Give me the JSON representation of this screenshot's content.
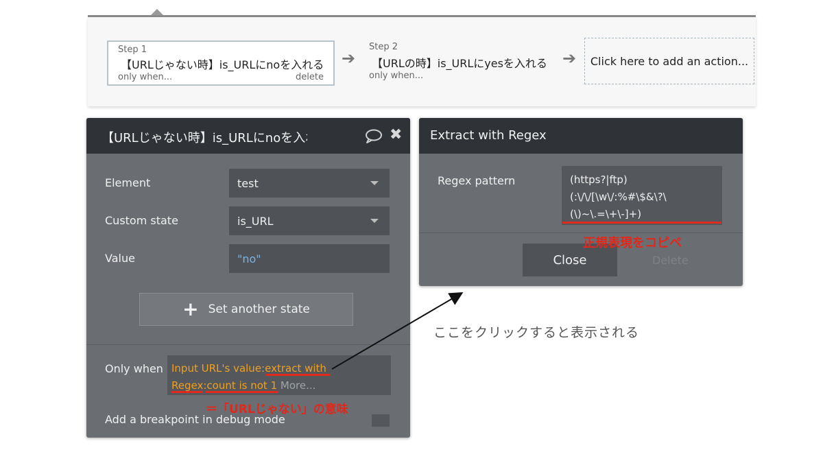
{
  "workflow": {
    "step1": {
      "label": "Step 1",
      "title": "【URLじゃない時】is_URLにnoを入れる",
      "sub": "only when...",
      "delete": "delete"
    },
    "step2": {
      "label": "Step 2",
      "title": "【URLの時】is_URLにyesを入れる",
      "sub": "only when..."
    },
    "add_action": "Click here to add an action..."
  },
  "action_panel": {
    "title": "【URLじゃない時】is_URLにnoを入れる",
    "element_label": "Element",
    "element_value": "test",
    "custom_state_label": "Custom state",
    "custom_state_value": "is_URL",
    "value_label": "Value",
    "value_value": "\"no\"",
    "set_another_state": "Set another state",
    "only_when_label": "Only when",
    "condition_part1": "Input URL's value:",
    "condition_part2": "extract with",
    "condition_part3": "Regex:",
    "condition_part4": "count is not 1",
    "condition_more": "More...",
    "breakpoint_label": "Add a breakpoint in debug mode"
  },
  "regex_panel": {
    "title": "Extract with Regex",
    "pattern_label": "Regex pattern",
    "pattern_lines": [
      "(https?|ftp)",
      "(:\\/\\/[\\w\\/:%#\\$&\\?\\",
      "(\\)~\\.=\\+\\-]+)"
    ],
    "close_label": "Close",
    "delete_label": "Delete"
  },
  "annotations": {
    "copy_note": "正規表現をコピペ",
    "meaning_note": "＝「URLじゃない」の意味",
    "click_note": "ここをクリックすると表示される"
  },
  "colors": {
    "panel_bg": "#6a6e72",
    "panel_header": "#2f3337",
    "condition_text": "#f0a020",
    "value_text": "#7ab3e6",
    "annotation_red": "#e0281c"
  }
}
